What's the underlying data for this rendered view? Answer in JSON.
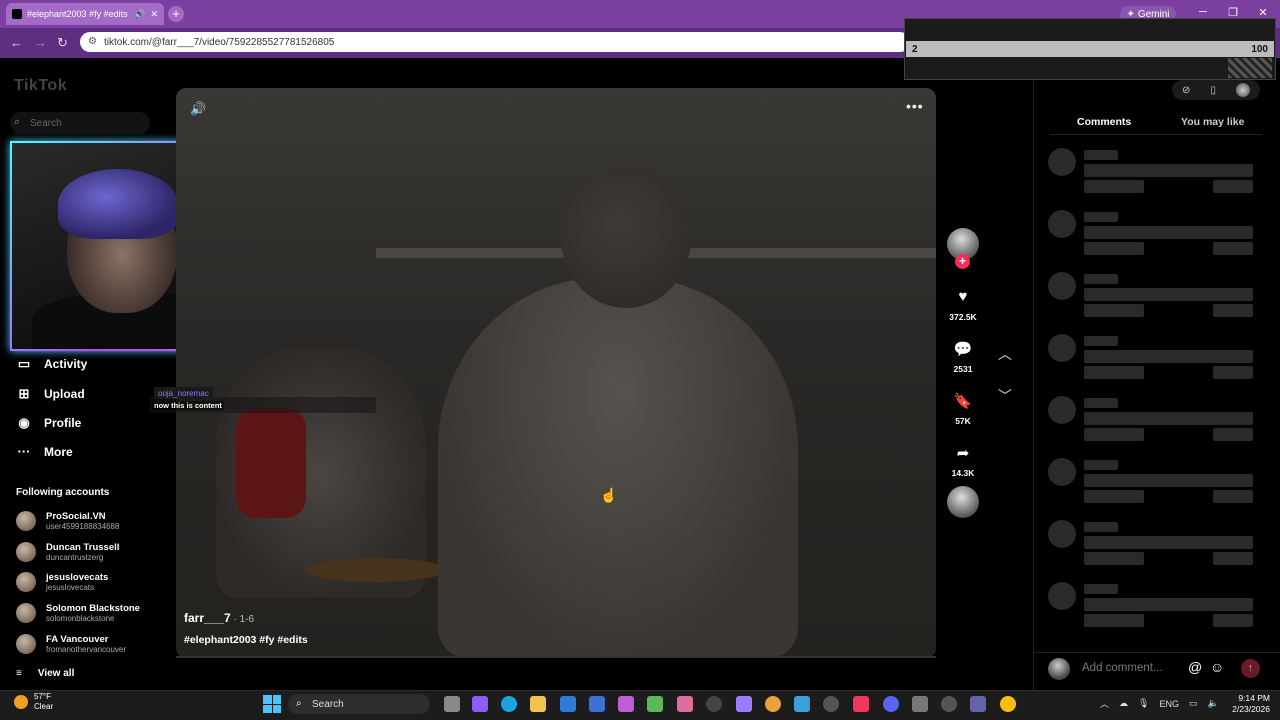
{
  "browser": {
    "tab_title": "#elephant2003 #fy #edits |",
    "new_tab": "+",
    "gemini_label": "Gemini",
    "url": "tiktok.com/@farr___7/video/7592285527781526805"
  },
  "overlay": {
    "left_value": "2",
    "right_value": "100"
  },
  "sidebar": {
    "logo": "TikTok",
    "search_placeholder": "Search",
    "nav": [
      {
        "label": "Activity",
        "icon": "activity-icon"
      },
      {
        "label": "Upload",
        "icon": "upload-icon"
      },
      {
        "label": "Profile",
        "icon": "profile-icon"
      },
      {
        "label": "More",
        "icon": "more-icon"
      }
    ],
    "following_header": "Following accounts",
    "accounts": [
      {
        "name": "ProSocial.VN",
        "handle": "user4599188834688"
      },
      {
        "name": "Duncan Trussell",
        "handle": "duncantrustzerg"
      },
      {
        "name": "jesuslovecats",
        "handle": "jesuslovecats"
      },
      {
        "name": "Solomon Blackstone",
        "handle": "solomonblackstone"
      },
      {
        "name": "FA Vancouver",
        "handle": "fromanothervancouver"
      }
    ],
    "view_all": "View all"
  },
  "video": {
    "overlay_tag": "ooja_noremac",
    "overlay_text": "now this is content",
    "author": "farr___7",
    "date": " · 1-6",
    "hashtags": "#elephant2003 #fy #edits"
  },
  "actions": {
    "likes": "372.5K",
    "comments": "2531",
    "saves": "57K",
    "shares": "14.3K"
  },
  "panel": {
    "tab_comments": "Comments",
    "tab_you_may_like": "You may like",
    "comment_placeholder": "Add comment...",
    "at_symbol": "@"
  },
  "taskbar": {
    "temp": "57°F",
    "weather": "Clear",
    "search": "Search",
    "lang": "ENG",
    "time": "9:14 PM",
    "date": "2/23/2026"
  }
}
